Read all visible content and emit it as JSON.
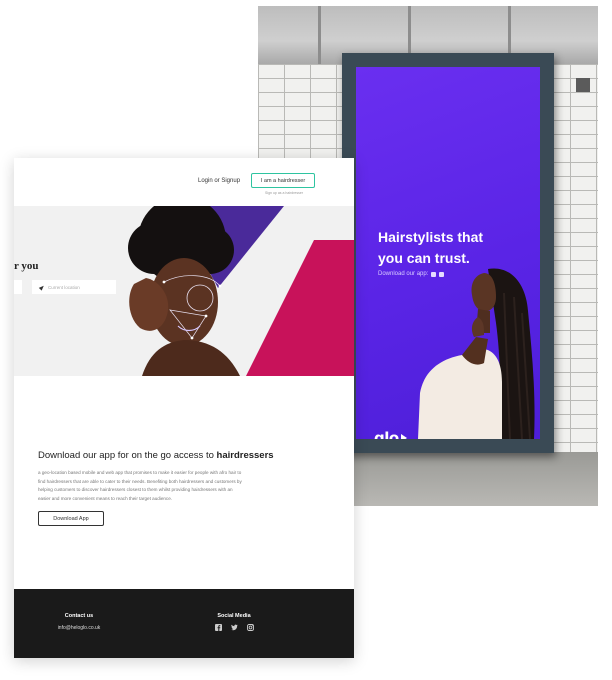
{
  "poster": {
    "headline": "Hairstylists that\nyou can trust.",
    "download_text": "Download our app:",
    "logo_text": "glo"
  },
  "site": {
    "header": {
      "login_label": "Login or Signup",
      "hairdresser_button_label": "I am a hairdresser",
      "tagline": "Sign up as a hairdresser"
    },
    "hero": {
      "title_fragment": "r you",
      "location_placeholder": "Current location"
    },
    "download": {
      "title_prefix": "Download our app for on the go access to",
      "title_highlight": "hairdressers",
      "description": "a geo-location based mobile and web app that promises to make it easier for people with afro hair to find hairdressers that are able to cater to their needs. Benefiting both hairdressers and customers by helping customers to discover hairdressers closest to them whilst providing hairdressers with an easier and more convenient means to reach their target audience.",
      "button_label": "Download App"
    },
    "footer": {
      "contact_heading": "Contact us",
      "contact_email": "info@heloglo.co.uk",
      "social_heading": "Social Media",
      "social_icons": [
        "facebook-icon",
        "twitter-icon",
        "instagram-icon"
      ]
    }
  },
  "colors": {
    "poster_purple": "#5a24e6",
    "hero_magenta": "#c8125a",
    "hero_triangle_purple": "#4a2a9a",
    "accent_green": "#2ec4a0",
    "footer_bg": "#1a1a1a"
  }
}
